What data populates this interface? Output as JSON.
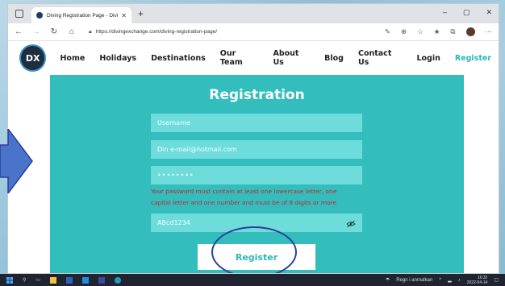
{
  "browser": {
    "tab_title": "Diving Registration Page - Divin",
    "url": "https://divingexchange.com/diving-registration-page/"
  },
  "site": {
    "logo_text": "DX",
    "menu": [
      {
        "label": "Home"
      },
      {
        "label": "Holidays"
      },
      {
        "label": "Destinations"
      },
      {
        "label": "Our Team"
      },
      {
        "label": "About Us"
      },
      {
        "label": "Blog"
      },
      {
        "label": "Contact Us"
      },
      {
        "label": "Login"
      },
      {
        "label": "Register"
      }
    ]
  },
  "form": {
    "title": "Registration",
    "username_placeholder": "Username",
    "email_value": "Din e-mail@hotmail.com",
    "password_value": "••••••••",
    "error_line1": "Your password must contain at least one lowercase letter, one",
    "error_line2": "capital letter and one number and must be of 8 digits or more.",
    "confirm_value": "ABcd1234",
    "submit_label": "Register"
  },
  "taskbar": {
    "weather": "Regn i anmalkan",
    "time": "16:32",
    "date": "2022-04-14"
  },
  "colors": {
    "accent": "#33bdbd",
    "error": "#c62828",
    "annotation": "#2a3f9a"
  }
}
